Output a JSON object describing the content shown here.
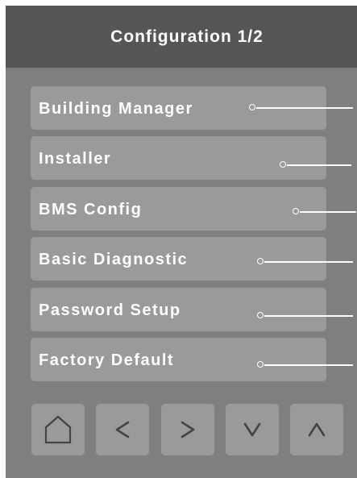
{
  "header": {
    "title": "Configuration 1/2"
  },
  "menu": {
    "items": [
      {
        "label": "Building Manager"
      },
      {
        "label": "Installer"
      },
      {
        "label": "BMS Config"
      },
      {
        "label": "Basic Diagnostic"
      },
      {
        "label": "Password Setup"
      },
      {
        "label": "Factory Default"
      }
    ]
  },
  "nav": {
    "buttons": [
      {
        "icon": "home-icon"
      },
      {
        "icon": "chevron-left-icon"
      },
      {
        "icon": "chevron-right-icon"
      },
      {
        "icon": "chevron-down-icon"
      },
      {
        "icon": "chevron-up-icon"
      }
    ]
  },
  "colors": {
    "background": "#7f7f7f",
    "header": "#565656",
    "button": "#9a9a9a",
    "text": "#ffffff",
    "icon": "#444444"
  }
}
